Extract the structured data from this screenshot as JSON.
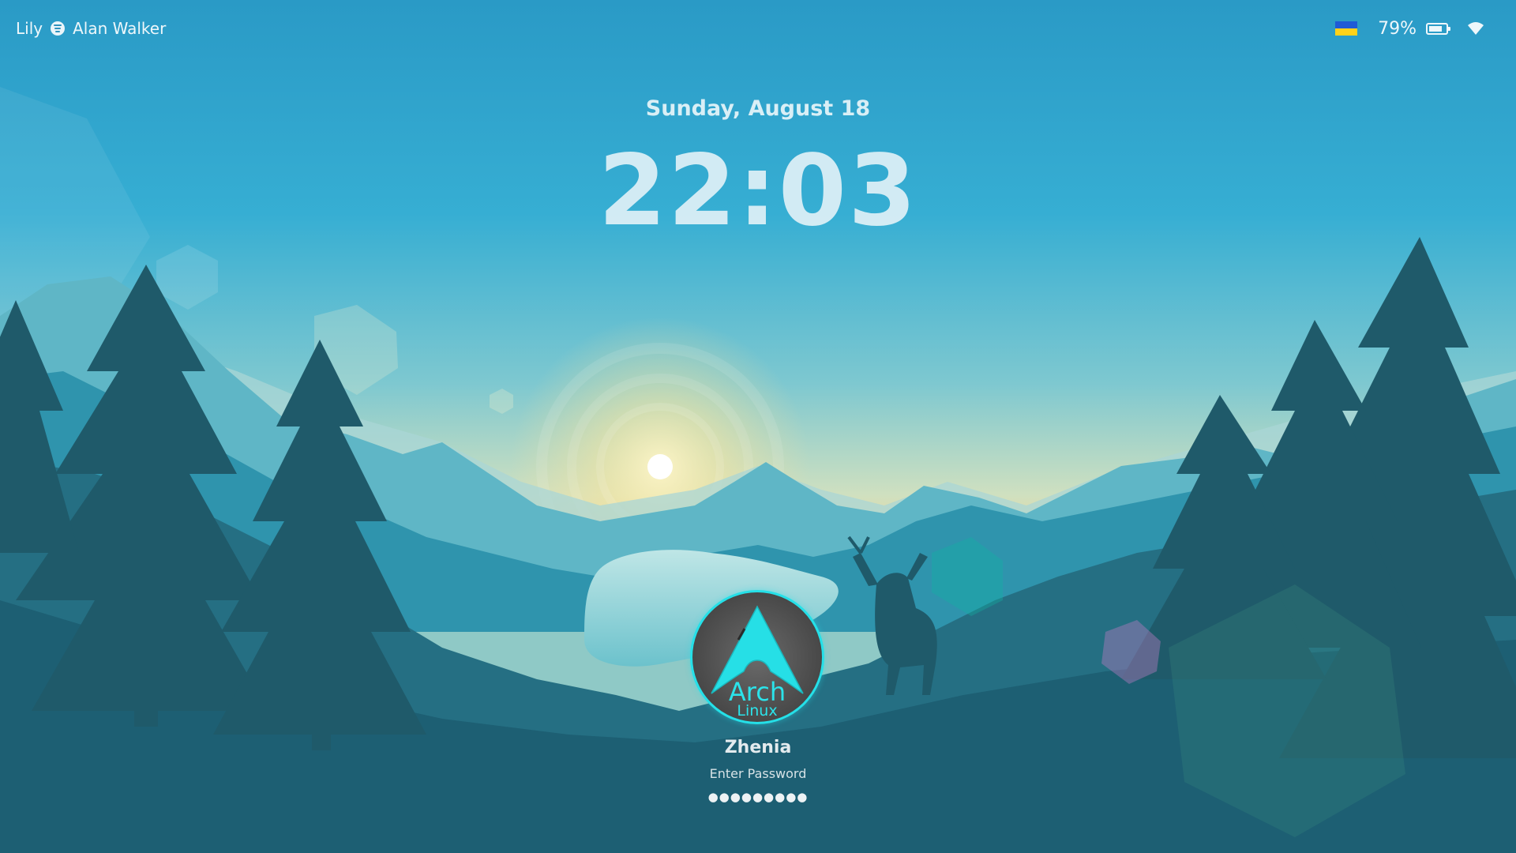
{
  "topbar": {
    "song": "Lily",
    "artist": "Alan Walker",
    "battery_percent": "79%",
    "battery_level": 0.79
  },
  "clock": {
    "date": "Sunday, August 18",
    "time": "22:03"
  },
  "avatar": {
    "logo_word": "Arch",
    "logo_sub": "Linux"
  },
  "login": {
    "username": "Zhenia",
    "password_label": "Enter Password",
    "password_masked": "●●●●●●●●●"
  },
  "colors": {
    "accent": "#25e0e8",
    "flag_blue": "#1f5bd6",
    "flag_yellow": "#ffd21a"
  }
}
